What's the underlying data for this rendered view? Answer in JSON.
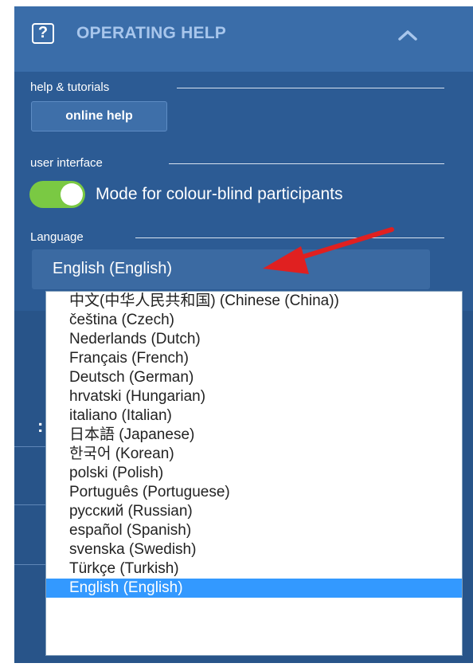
{
  "colors": {
    "panel": "#2e5e98",
    "toggle_on": "#7ac943",
    "selection": "#3399ff",
    "annotation_arrow": "#e02020"
  },
  "header": {
    "help_icon_glyph": "?",
    "title": "OPERATING HELP",
    "collapse_icon": "chevron-up-icon"
  },
  "help_tutorials": {
    "legend": "help & tutorials",
    "online_help_label": "online help"
  },
  "user_interface": {
    "legend": "user interface",
    "toggle_state": "on",
    "toggle_label": "Mode for colour-blind participants"
  },
  "language": {
    "legend": "Language",
    "selected_value": "English (English)",
    "options": [
      "中文(中华人民共和国) (Chinese (China))",
      "čeština (Czech)",
      "Nederlands (Dutch)",
      "Français (French)",
      "Deutsch (German)",
      "hrvatski (Hungarian)",
      "italiano (Italian)",
      "日本語 (Japanese)",
      "한국어 (Korean)",
      "polski (Polish)",
      "Português (Portuguese)",
      "русский (Russian)",
      "español (Spanish)",
      "svenska (Swedish)",
      "Türkçe (Turkish)",
      "English (English)"
    ],
    "highlighted_option": "English (English)"
  },
  "background_fragment": ":"
}
